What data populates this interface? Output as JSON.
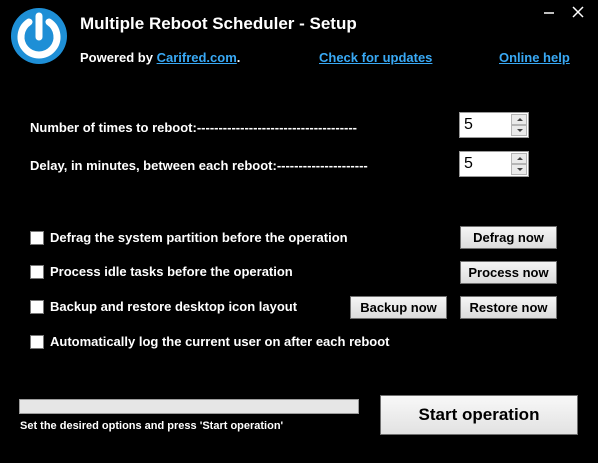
{
  "header": {
    "title": "Multiple Reboot Scheduler - Setup",
    "powered_prefix": "Powered by ",
    "powered_link": "Carifred.com",
    "powered_suffix": ".",
    "check_updates": "Check for updates",
    "online_help": "Online help",
    "link_color": "#39a9f5",
    "logo_color": "#1e8fd6"
  },
  "window_controls": {
    "minimize": "—",
    "close": "✕"
  },
  "settings": {
    "reboot_times_label": "Number of times to reboot:-------------------------------------",
    "reboot_times_value": "5",
    "delay_label": "Delay, in minutes, between each reboot:---------------------",
    "delay_value": "5"
  },
  "options": [
    {
      "label": "Defrag the system partition before the operation",
      "checked": false
    },
    {
      "label": "Process idle tasks before the operation",
      "checked": false
    },
    {
      "label": "Backup and restore desktop icon layout",
      "checked": false
    },
    {
      "label": "Automatically log the current user on after each reboot",
      "checked": false
    }
  ],
  "buttons": {
    "defrag": "Defrag now",
    "process": "Process now",
    "backup": "Backup now",
    "restore": "Restore now",
    "start": "Start operation"
  },
  "progress": {
    "fraction": 0.0,
    "fill_color": "#06b025"
  },
  "status_text": "Set the desired options and press 'Start operation'"
}
